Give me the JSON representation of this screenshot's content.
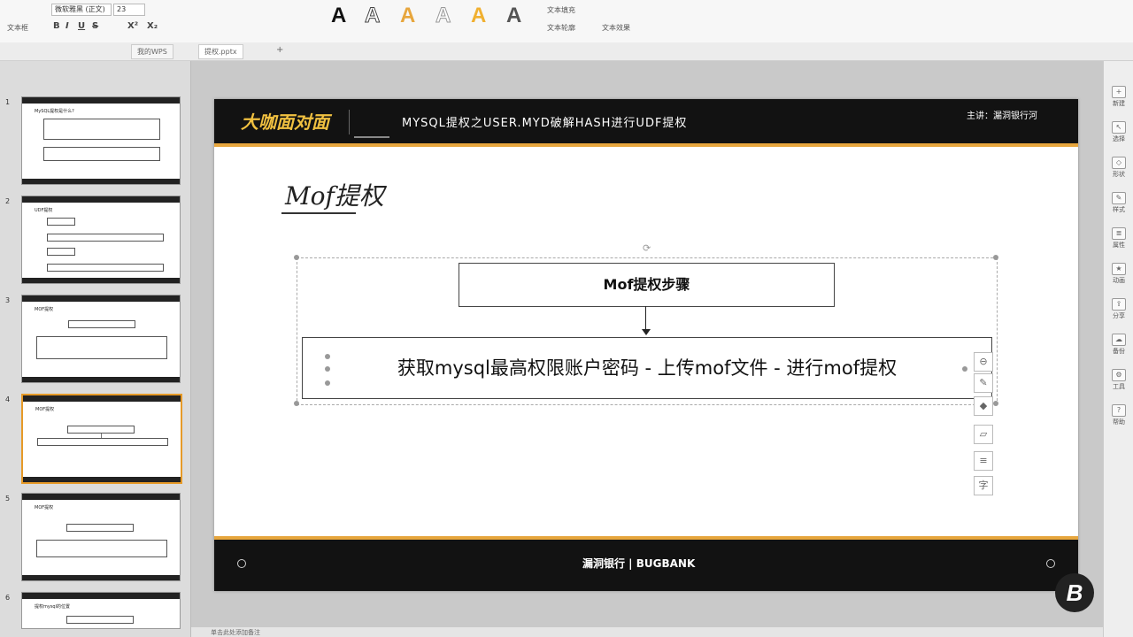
{
  "ribbon": {
    "textbox_label": "文本框",
    "font_name": "微软雅黑 (正文)",
    "font_size": "23",
    "bold": "B",
    "italic": "I",
    "underline": "U",
    "strike": "S",
    "superscript": "X²",
    "subscript": "X₂",
    "text_fill": "文本填充",
    "text_outline": "文本轮廓",
    "text_effects": "文本效果",
    "bigA": "A"
  },
  "tabs": [
    {
      "label": "我的WPS"
    },
    {
      "label": "提权.pptx"
    }
  ],
  "thumbnails": [
    {
      "num": "1",
      "title": "MySQL提权是什么?"
    },
    {
      "num": "2",
      "title": "UDF提权"
    },
    {
      "num": "3",
      "title": "MOF提权"
    },
    {
      "num": "4",
      "title": "MOF提权"
    },
    {
      "num": "5",
      "title": "MOF提权"
    },
    {
      "num": "6",
      "title": "提权mysql的位置"
    }
  ],
  "slide": {
    "header_title": "MYSQL提权之USER.MYD破解HASH进行UDF提权",
    "lecturer": "主讲：漏洞银行河",
    "heading": "Mof提权",
    "steps_label": "Mof提权步骤",
    "process_text": "获取mysql最高权限账户密码 - 上传mof文件 - 进行mof提权",
    "footer_brand": "漏洞银行 | BUGBANK",
    "logo_text": "大咖面对面"
  },
  "rightbar": [
    {
      "label": "新建",
      "icon": "new-icon"
    },
    {
      "label": "选择",
      "icon": "select-icon"
    },
    {
      "label": "形状",
      "icon": "shape-icon"
    },
    {
      "label": "样式",
      "icon": "style-icon"
    },
    {
      "label": "属性",
      "icon": "property-icon"
    },
    {
      "label": "动画",
      "icon": "animation-icon"
    },
    {
      "label": "分享",
      "icon": "share-icon"
    },
    {
      "label": "备份",
      "icon": "backup-icon"
    },
    {
      "label": "工具",
      "icon": "tools-icon"
    },
    {
      "label": "帮助",
      "icon": "help-icon"
    }
  ],
  "status": {
    "text": "单击此处添加备注"
  },
  "watermark": "B",
  "colors": {
    "accent": "#e7a63d",
    "slide_dark": "#121212"
  }
}
